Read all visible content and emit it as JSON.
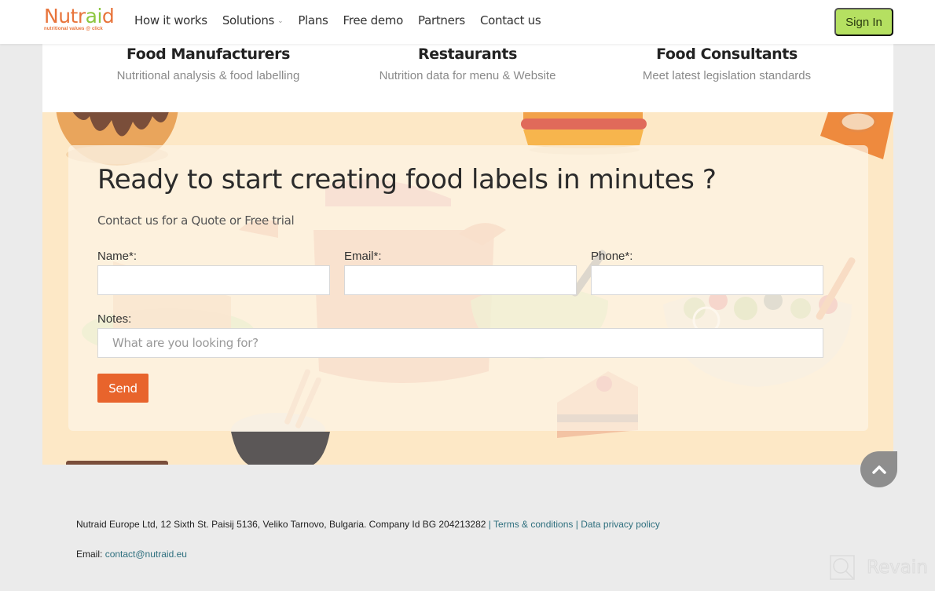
{
  "header": {
    "logo": {
      "word_part1": "Nutr",
      "word_part2": "ai",
      "word_part3": "d",
      "tagline": "nutritional values @ click"
    },
    "nav": [
      {
        "label": "How it works"
      },
      {
        "label": "Solutions",
        "has_dropdown": true,
        "dropdown_icon": "⌄"
      },
      {
        "label": "Plans"
      },
      {
        "label": "Free demo"
      },
      {
        "label": "Partners"
      },
      {
        "label": "Contact us"
      }
    ],
    "signin_label": "Sign In"
  },
  "segments": [
    {
      "title": "Food Manufacturers",
      "subtitle": "Nutritional analysis & food labelling"
    },
    {
      "title": "Restaurants",
      "subtitle": "Nutrition data for menu & Website"
    },
    {
      "title": "Food Consultants",
      "subtitle": "Meet latest legislation standards"
    }
  ],
  "contact_form": {
    "title": "Ready to start creating food labels in minutes ?",
    "subtitle": "Contact us for a Quote or Free trial",
    "fields": {
      "name": {
        "label": "Name*:",
        "value": "",
        "placeholder": ""
      },
      "email": {
        "label": "Email*:",
        "value": "",
        "placeholder": ""
      },
      "phone": {
        "label": "Phone*:",
        "value": "",
        "placeholder": ""
      },
      "notes": {
        "label": "Notes:",
        "value": "",
        "placeholder": "What are you looking for?"
      }
    },
    "send_label": "Send"
  },
  "scroll_top": {
    "icon": "chevron-up"
  },
  "footer": {
    "address": "Nutraid Europe Ltd, 12 Sixth St. Paisij 5136, Veliko Tarnovo, Bulgaria. Company Id BG 204213282",
    "separator": "|",
    "terms_label": "Terms & conditions",
    "privacy_label": "Data privacy policy",
    "email_label": "Email:",
    "email_value": "contact@nutraid.eu"
  },
  "watermark": {
    "text": "Revain"
  },
  "colors": {
    "brand_orange": "#e8743b",
    "brand_green": "#8cc63f",
    "signin_bg": "#b5e061",
    "send_bg": "#e8642c",
    "hero_bg": "#fde8c6",
    "link": "#2e6f7e",
    "footer_bg": "#ebebeb"
  }
}
